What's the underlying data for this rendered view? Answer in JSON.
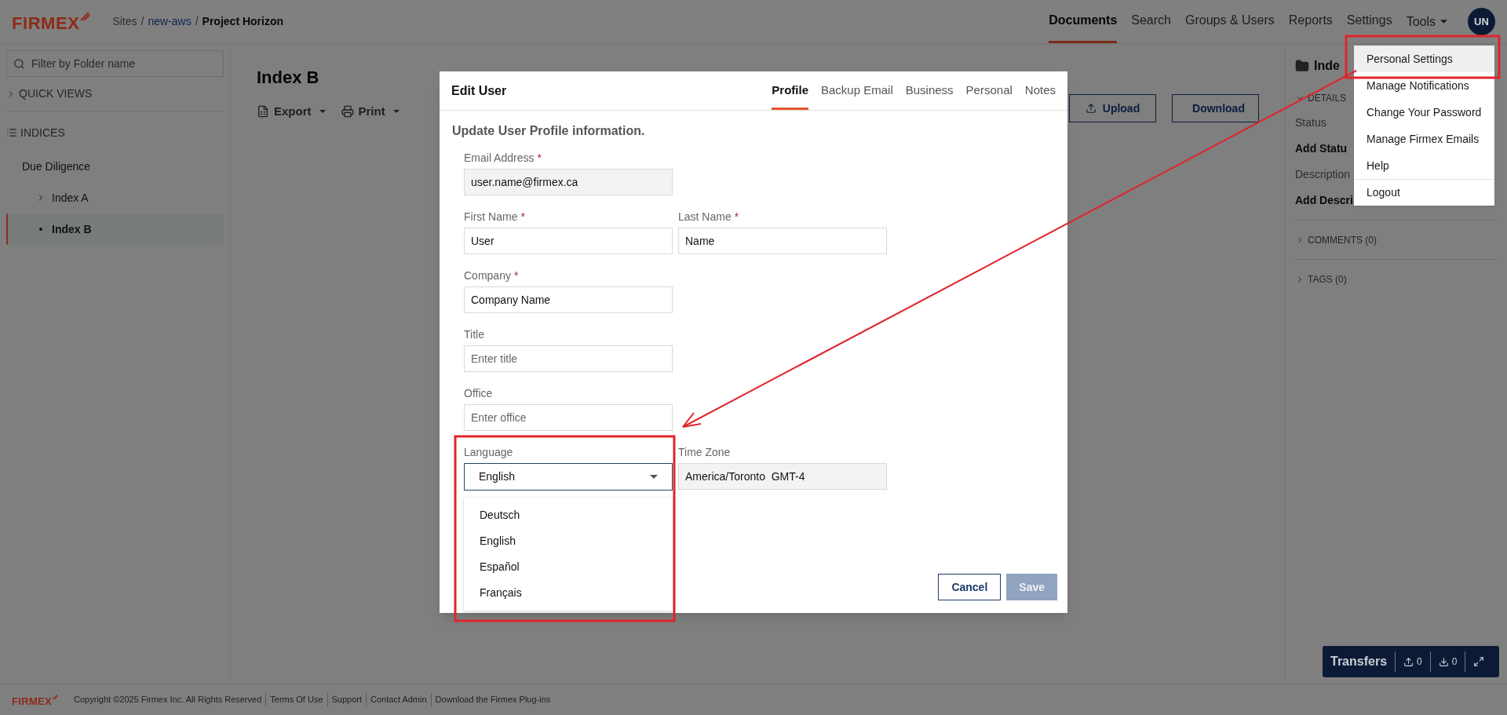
{
  "header": {
    "logo": "FIRMEX",
    "breadcrumb": [
      {
        "label": "Sites",
        "kind": "text"
      },
      {
        "label": "/",
        "kind": "separator"
      },
      {
        "label": "new-aws",
        "kind": "link"
      },
      {
        "label": "/",
        "kind": "separator"
      },
      {
        "label": "Project Horizon",
        "kind": "current"
      }
    ],
    "nav": [
      {
        "label": "Documents",
        "selected": true
      },
      {
        "label": "Search",
        "selected": false
      },
      {
        "label": "Groups & Users",
        "selected": false
      },
      {
        "label": "Reports",
        "selected": false
      },
      {
        "label": "Settings",
        "selected": false
      }
    ],
    "tools": "Tools",
    "avatar": "UN"
  },
  "user_menu": [
    {
      "label": "Personal Settings",
      "highlighted": true,
      "divider_before": false
    },
    {
      "label": "Manage Notifications",
      "highlighted": false,
      "divider_before": false
    },
    {
      "label": "Change Your Password",
      "highlighted": false,
      "divider_before": false
    },
    {
      "label": "Manage Firmex Emails",
      "highlighted": false,
      "divider_before": false
    },
    {
      "label": "Help",
      "highlighted": false,
      "divider_before": false
    },
    {
      "label": "Logout",
      "highlighted": false,
      "divider_before": true
    }
  ],
  "sidebar": {
    "filter": {
      "placeholder": "Filter by Folder name"
    },
    "quick_views": {
      "label": "QUICK VIEWS",
      "expanded": false
    },
    "indices": "INDICES",
    "tree": [
      {
        "label": "Due Diligence",
        "kind": "root",
        "selected": false,
        "children": [
          {
            "label": "Index A",
            "kind": "branch",
            "expanded": false,
            "selected": false
          },
          {
            "label": "Index B",
            "kind": "leaf",
            "selected": true
          }
        ]
      }
    ]
  },
  "main": {
    "title": "Index B",
    "toolbar": [
      {
        "label": "Export",
        "kind": "export"
      },
      {
        "label": "Print",
        "kind": "print"
      }
    ],
    "actions": [
      {
        "label": "Upload",
        "kind": "upload"
      },
      {
        "label": "Download",
        "kind": "download"
      }
    ]
  },
  "details_panel": {
    "title": "Inde",
    "sections": [
      {
        "label": "DETAILS",
        "expanded": true
      },
      {
        "label": "COMMENTS (0)",
        "expanded": false
      },
      {
        "label": "TAGS (0)",
        "expanded": false
      }
    ],
    "fields": [
      {
        "label": "Status",
        "value": "Add Statu"
      },
      {
        "label": "Description",
        "value": "Add Descri"
      }
    ]
  },
  "dialog": {
    "title": "Edit User",
    "tabs": [
      {
        "label": "Profile",
        "selected": true
      },
      {
        "label": "Backup Email",
        "selected": false
      },
      {
        "label": "Business",
        "selected": false
      },
      {
        "label": "Personal",
        "selected": false
      },
      {
        "label": "Notes",
        "selected": false
      }
    ],
    "subtitle": "Update User Profile information.",
    "required_mark": "*",
    "field_rows": [
      [
        {
          "label": "Email Address",
          "required": true,
          "value": "user.name@firmex.ca",
          "readonly": true
        }
      ],
      [
        {
          "label": "First Name",
          "required": true,
          "value": "User",
          "readonly": false
        },
        {
          "label": "Last Name",
          "required": true,
          "value": "Name",
          "readonly": false
        }
      ],
      [
        {
          "label": "Company",
          "required": true,
          "value": "Company Name",
          "readonly": false
        }
      ],
      [
        {
          "label": "Title",
          "required": false,
          "placeholder": "Enter title",
          "readonly": false
        }
      ],
      [
        {
          "label": "Office",
          "required": false,
          "placeholder": "Enter office",
          "readonly": false
        }
      ]
    ],
    "language": {
      "label": "Language",
      "value": "English",
      "expanded": true,
      "options": [
        "Deutsch",
        "English",
        "Español",
        "Français"
      ]
    },
    "time_zone": {
      "label": "Time Zone",
      "value": "America/Toronto  GMT-4"
    },
    "buttons": [
      {
        "label": "Cancel",
        "kind": "secondary",
        "disabled": false
      },
      {
        "label": "Save",
        "kind": "primary",
        "disabled": true
      }
    ]
  },
  "transfers": {
    "label": "Transfers",
    "uploads": "0",
    "downloads": "0"
  },
  "footer": {
    "logo": "FIRMEX",
    "copyright": "Copyright ©2025 Firmex Inc. All Rights Reserved",
    "links": [
      "Terms Of Use",
      "Support",
      "Contact Admin",
      "Download the Firmex Plug-ins"
    ]
  }
}
